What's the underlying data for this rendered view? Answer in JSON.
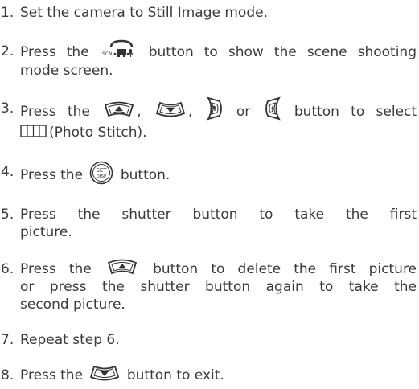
{
  "steps": [
    {
      "num": "1.",
      "text": "Set the camera to Still Image mode."
    },
    {
      "num": "2.",
      "before": "Press the",
      "after": "button to show the scene shooting",
      "line2": "mode screen."
    },
    {
      "num": "3.",
      "before": "Press the",
      "sep1": ",",
      "sep2": ",",
      "sep3": "or",
      "after": "button to select",
      "line2": "(Photo Stitch)."
    },
    {
      "num": "4.",
      "before": "Press the",
      "after": "button."
    },
    {
      "num": "5.",
      "line1": "Press the shutter button to take the first",
      "line2": "picture."
    },
    {
      "num": "6.",
      "before": "Press the",
      "after": "button to delete the first picture",
      "line2": "or press the shutter button again to take the",
      "line3": "second picture."
    },
    {
      "num": "7.",
      "text": "Repeat step 6."
    },
    {
      "num": "8.",
      "before": "Press the",
      "after": "button to exit."
    }
  ],
  "icons": {
    "scene_label": "SCN",
    "set_label_top": "SET",
    "set_label_bottom": "DISP"
  },
  "colors": {
    "text": "#3a3a3a",
    "icon_stroke": "#333333"
  }
}
